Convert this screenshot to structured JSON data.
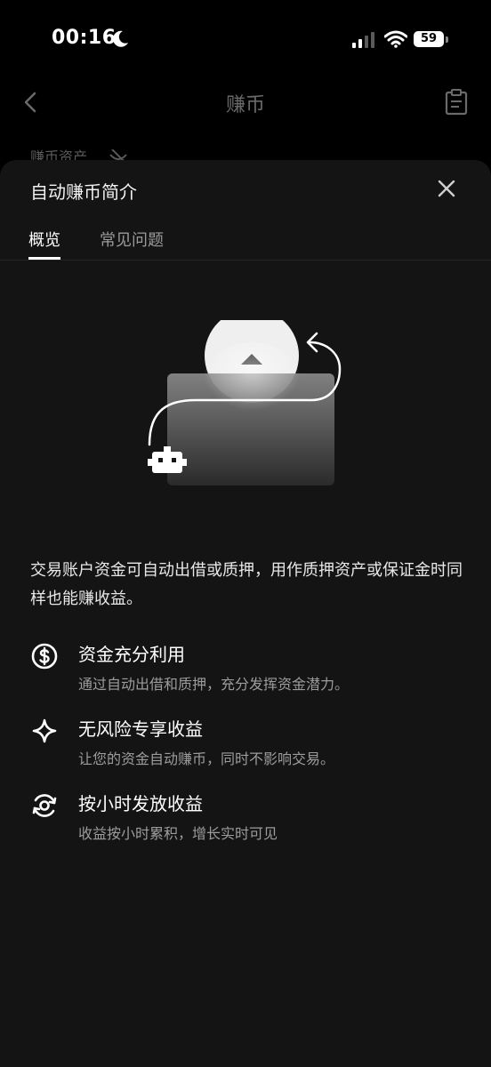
{
  "status_bar": {
    "time": "00:16",
    "battery": "59"
  },
  "header": {
    "title": "赚币",
    "peek_label": "赚币资产"
  },
  "sheet": {
    "title": "自动赚币简介",
    "tabs": [
      {
        "label": "概览",
        "active": true
      },
      {
        "label": "常见问题",
        "active": false
      }
    ],
    "intro": "交易账户资金可自动出借或质押，用作质押资产或保证金时同样也能赚收益。",
    "features": [
      {
        "icon": "dollar-circle-icon",
        "title": "资金充分利用",
        "description": "通过自动出借和质押，充分发挥资金潜力。"
      },
      {
        "icon": "sparkle-icon",
        "title": "无风险专享收益",
        "description": "让您的资金自动赚币，同时不影响交易。"
      },
      {
        "icon": "hourly-refresh-icon",
        "title": "按小时发放收益",
        "description": "收益按小时累积，增长实时可见"
      }
    ]
  }
}
